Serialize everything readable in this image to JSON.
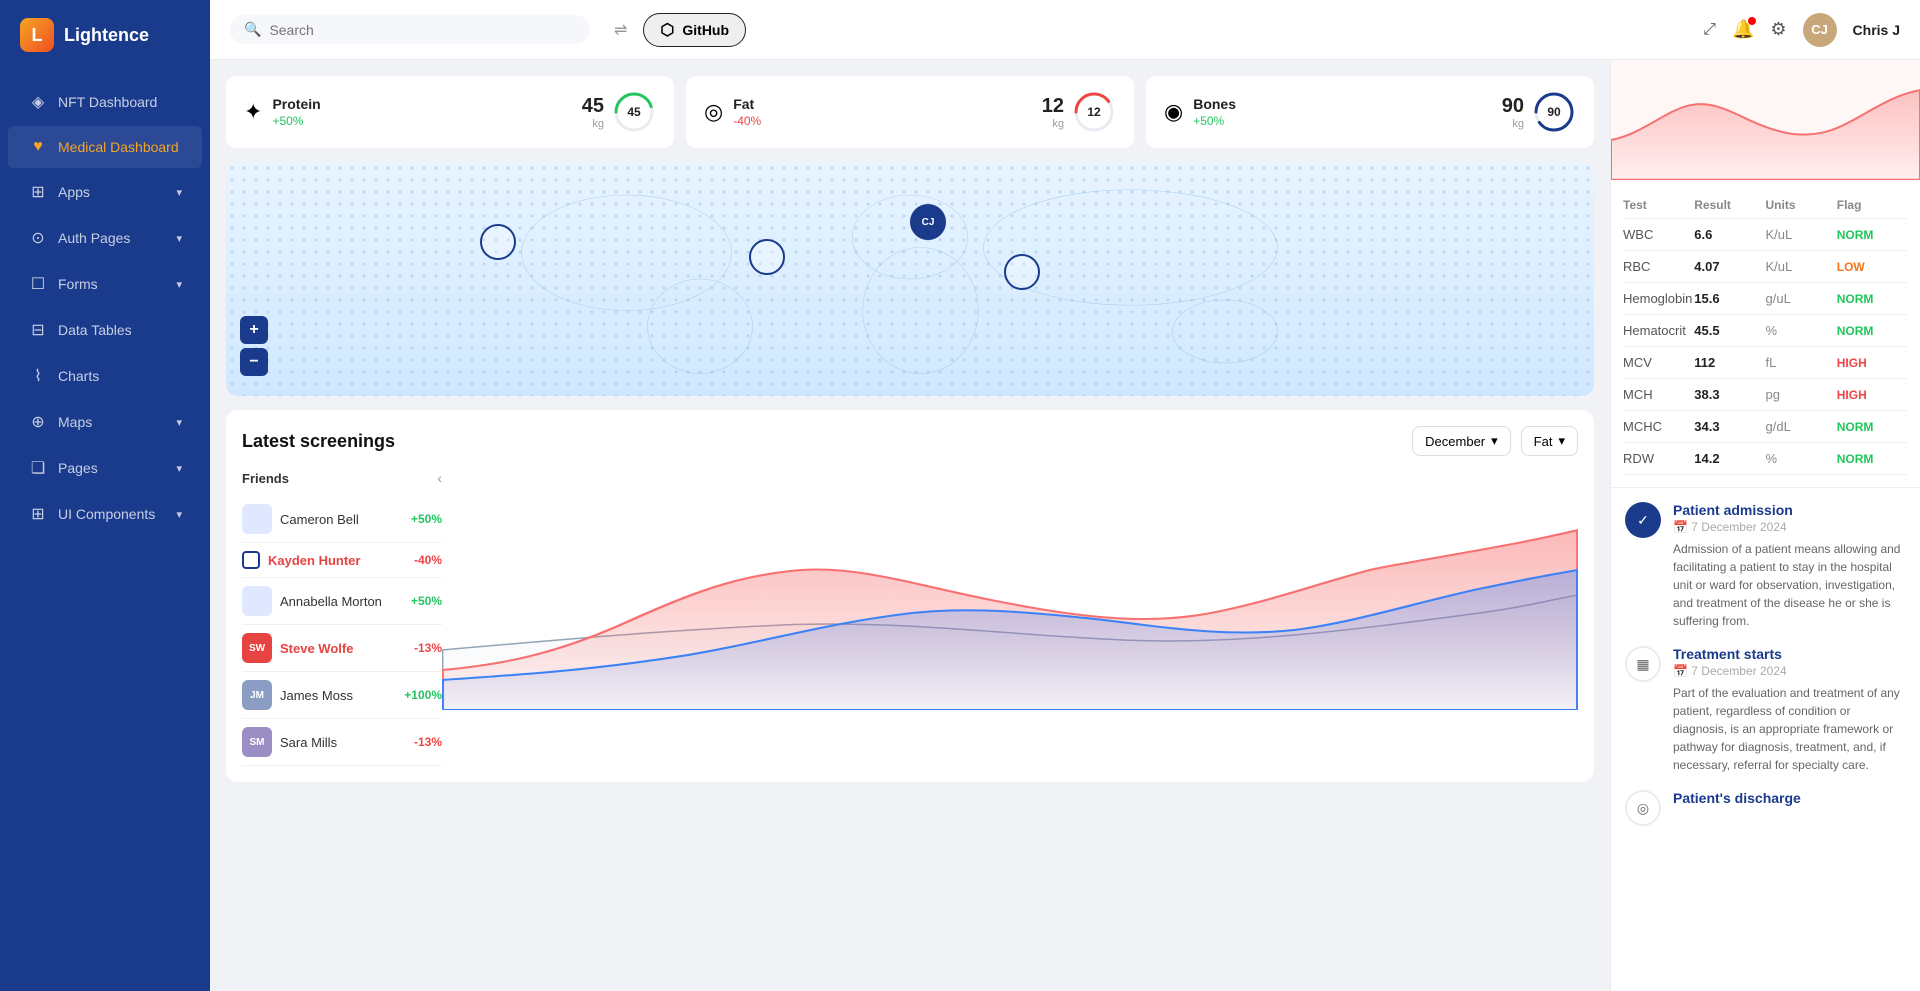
{
  "app": {
    "title": "Lightence"
  },
  "sidebar": {
    "logo": "L",
    "items": [
      {
        "id": "nft-dashboard",
        "label": "NFT Dashboard",
        "icon": "◈"
      },
      {
        "id": "medical-dashboard",
        "label": "Medical Dashboard",
        "icon": "♥",
        "active": true
      },
      {
        "id": "apps",
        "label": "Apps",
        "icon": "⊞",
        "hasChevron": true
      },
      {
        "id": "auth-pages",
        "label": "Auth Pages",
        "icon": "⊙",
        "hasChevron": true
      },
      {
        "id": "forms",
        "label": "Forms",
        "icon": "☐",
        "hasChevron": true
      },
      {
        "id": "data-tables",
        "label": "Data Tables",
        "icon": "⊟"
      },
      {
        "id": "charts",
        "label": "Charts",
        "icon": "⌇"
      },
      {
        "id": "maps",
        "label": "Maps",
        "icon": "⊕",
        "hasChevron": true
      },
      {
        "id": "pages",
        "label": "Pages",
        "icon": "❏",
        "hasChevron": true
      },
      {
        "id": "ui-components",
        "label": "UI Components",
        "icon": "⊞",
        "hasChevron": true
      }
    ]
  },
  "topbar": {
    "search_placeholder": "Search",
    "github_label": "GitHub",
    "username": "Chris J"
  },
  "stats": [
    {
      "icon": "✦",
      "name": "Protein",
      "change": "+50%",
      "direction": "up",
      "value": "45",
      "unit": "kg",
      "progress": 45,
      "color": "#22c55e"
    },
    {
      "icon": "◎",
      "name": "Fat",
      "change": "-40%",
      "direction": "down",
      "value": "12",
      "unit": "kg",
      "progress": 40,
      "color": "#ef4444"
    },
    {
      "icon": "◉",
      "name": "Bones",
      "change": "+50%",
      "direction": "up",
      "value": "90",
      "unit": "kg",
      "progress": 90,
      "color": "#1a3a8c"
    }
  ],
  "screenings": {
    "title": "Latest screenings",
    "month_label": "December",
    "type_label": "Fat",
    "friends_title": "Friends",
    "friends": [
      {
        "id": "cameron",
        "name": "Cameron Bell",
        "change": "+50%",
        "direction": "up",
        "avatar": null
      },
      {
        "id": "kayden",
        "name": "Kayden Hunter",
        "change": "-40%",
        "direction": "down",
        "avatar": null,
        "active": true,
        "selected": true
      },
      {
        "id": "annabella",
        "name": "Annabella Morton",
        "change": "+50%",
        "direction": "up",
        "avatar": null
      },
      {
        "id": "steve",
        "name": "Steve Wolfe",
        "change": "-13%",
        "direction": "down",
        "avatar": "SW",
        "active": true
      },
      {
        "id": "james",
        "name": "James Moss",
        "change": "+100%",
        "direction": "up",
        "avatar": "JM"
      },
      {
        "id": "sara",
        "name": "Sara Mills",
        "change": "-13%",
        "direction": "down",
        "avatar": "SM"
      }
    ]
  },
  "lab_results": {
    "header": [
      "Test",
      "Result",
      "Units",
      "Flag"
    ],
    "rows": [
      {
        "test": "WBC",
        "result": "6.6",
        "unit": "K/uL",
        "flag": "NORM",
        "flag_type": "norm"
      },
      {
        "test": "RBC",
        "result": "4.07",
        "unit": "K/uL",
        "flag": "LOW",
        "flag_type": "low"
      },
      {
        "test": "Hemoglobin",
        "result": "15.6",
        "unit": "g/uL",
        "flag": "NORM",
        "flag_type": "norm"
      },
      {
        "test": "Hematocrit",
        "result": "45.5",
        "unit": "%",
        "flag": "NORM",
        "flag_type": "norm"
      },
      {
        "test": "MCV",
        "result": "112",
        "unit": "fL",
        "flag": "HIGH",
        "flag_type": "high"
      },
      {
        "test": "MCH",
        "result": "38.3",
        "unit": "pg",
        "flag": "HIGH",
        "flag_type": "high"
      },
      {
        "test": "MCHC",
        "result": "34.3",
        "unit": "g/dL",
        "flag": "NORM",
        "flag_type": "norm"
      },
      {
        "test": "RDW",
        "result": "14.2",
        "unit": "%",
        "flag": "NORM",
        "flag_type": "norm"
      }
    ]
  },
  "timeline": [
    {
      "id": "patient-admission",
      "title": "Patient admission",
      "date": "7 December 2024",
      "description": "Admission of a patient means allowing and facilitating a patient to stay in the hospital unit or ward for observation, investigation, and treatment of the disease he or she is suffering from.",
      "icon": "✓",
      "icon_style": "filled"
    },
    {
      "id": "treatment-starts",
      "title": "Treatment starts",
      "date": "7 December 2024",
      "description": "Part of the evaluation and treatment of any patient, regardless of condition or diagnosis, is an appropriate framework or pathway for diagnosis, treatment, and, if necessary, referral for specialty care.",
      "icon": "▦",
      "icon_style": "outline"
    },
    {
      "id": "patient-discharge",
      "title": "Patient's discharge",
      "date": "",
      "description": "",
      "icon": "◎",
      "icon_style": "outline"
    }
  ]
}
